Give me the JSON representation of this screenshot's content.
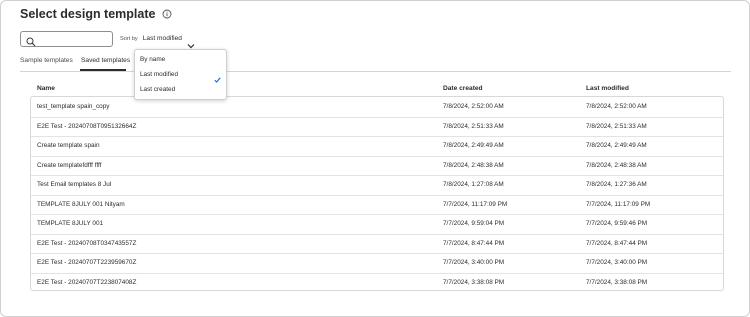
{
  "header": {
    "title": "Select design template",
    "info_icon": "info-icon"
  },
  "search": {
    "placeholder": "",
    "icon": "search-icon"
  },
  "sort": {
    "label": "Sort by",
    "value": "Last modified",
    "icon": "chevron-down-icon"
  },
  "tabs": [
    {
      "label": "Sample templates",
      "active": false
    },
    {
      "label": "Saved templates",
      "active": true
    }
  ],
  "sort_menu": {
    "options": [
      "By name",
      "Last modified",
      "Last created"
    ],
    "selected": "Last modified",
    "check_icon": "checkmark-icon",
    "accent": "#1473e6"
  },
  "table": {
    "headers": {
      "name": "Name",
      "created": "Date created",
      "modified": "Last modified"
    },
    "rows": [
      {
        "name": "test_template spain_copy",
        "created": "7/8/2024, 2:52:00 AM",
        "modified": "7/8/2024, 2:52:00 AM"
      },
      {
        "name": "E2E Test - 20240708T095132664Z",
        "created": "7/8/2024, 2:51:33 AM",
        "modified": "7/8/2024, 2:51:33 AM"
      },
      {
        "name": "Create template spain",
        "created": "7/8/2024, 2:49:49 AM",
        "modified": "7/8/2024, 2:49:49 AM"
      },
      {
        "name": "Create templatefdfff ffff",
        "created": "7/8/2024, 2:48:38 AM",
        "modified": "7/8/2024, 2:48:38 AM"
      },
      {
        "name": "Test Email templates 8 Jul",
        "created": "7/8/2024, 1:27:08 AM",
        "modified": "7/8/2024, 1:27:36 AM"
      },
      {
        "name": "TEMPLATE 8JULY 001 Nityam",
        "created": "7/7/2024, 11:17:09 PM",
        "modified": "7/7/2024, 11:17:09 PM"
      },
      {
        "name": "TEMPLATE 8JULY 001",
        "created": "7/7/2024, 9:59:04 PM",
        "modified": "7/7/2024, 9:59:46 PM"
      },
      {
        "name": "E2E Test - 20240708T034743557Z",
        "created": "7/7/2024, 8:47:44 PM",
        "modified": "7/7/2024, 8:47:44 PM"
      },
      {
        "name": "E2E Test - 20240707T223959670Z",
        "created": "7/7/2024, 3:40:00 PM",
        "modified": "7/7/2024, 3:40:00 PM"
      },
      {
        "name": "E2E Test - 20240707T223807408Z",
        "created": "7/7/2024, 3:38:08 PM",
        "modified": "7/7/2024, 3:38:08 PM"
      }
    ]
  }
}
